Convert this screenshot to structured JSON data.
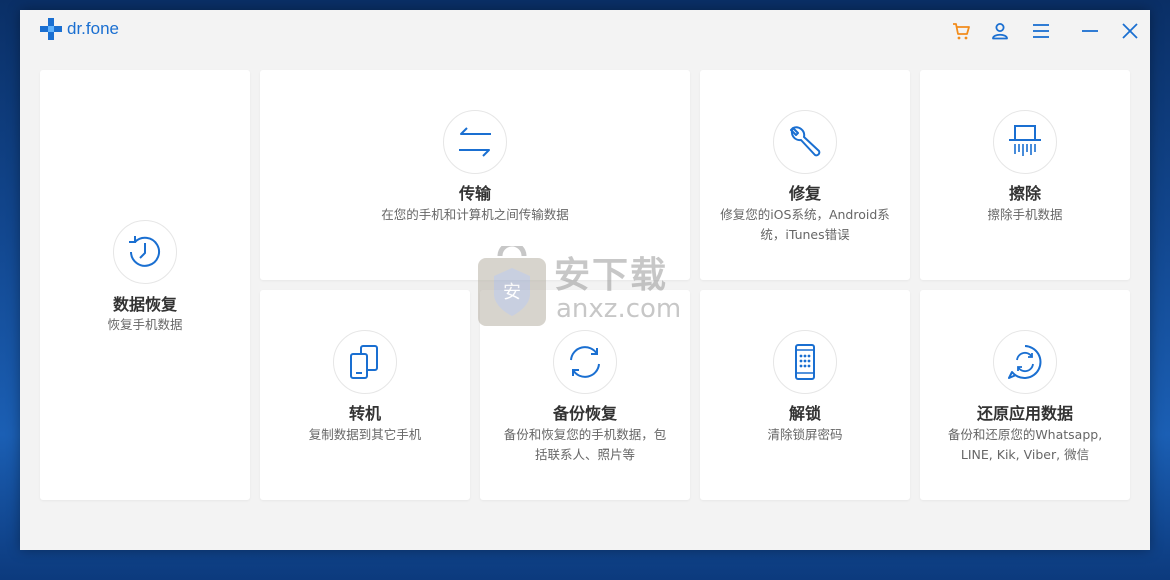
{
  "app": {
    "logo_text": "dr.fone"
  },
  "titlebar": {
    "cart_icon": "cart-icon",
    "account_icon": "user-icon",
    "menu_icon": "menu-icon",
    "minimize_icon": "minimize-icon",
    "close_icon": "close-icon",
    "cart_color": "#f28c1b",
    "accent_color": "#1a6fd1"
  },
  "cards": {
    "data_recovery": {
      "title": "数据恢复",
      "desc": "恢复手机数据",
      "icon": "clock-icon"
    },
    "transfer": {
      "title": "传输",
      "desc": "在您的手机和计算机之间传输数据",
      "icon": "transfer-arrows-icon"
    },
    "repair": {
      "title": "修复",
      "desc": "修复您的iOS系统，Android系统，iTunes错误",
      "icon": "wrench-icon"
    },
    "erase": {
      "title": "擦除",
      "desc": "擦除手机数据",
      "icon": "shredder-icon"
    },
    "phone_transfer": {
      "title": "转机",
      "desc": "复制数据到其它手机",
      "icon": "phone-switch-icon"
    },
    "backup_restore": {
      "title": "备份恢复",
      "desc": "备份和恢复您的手机数据，包括联系人、照片等",
      "icon": "sync-icon"
    },
    "unlock": {
      "title": "解锁",
      "desc": "清除锁屏密码",
      "icon": "phone-lock-icon"
    },
    "restore_social": {
      "title": "还原应用数据",
      "desc": "备份和还原您的Whatsapp, LINE, Kik, Viber, 微信",
      "icon": "chat-restore-icon"
    }
  },
  "watermark": {
    "text1": "安下载",
    "text2": "anxz.com"
  }
}
